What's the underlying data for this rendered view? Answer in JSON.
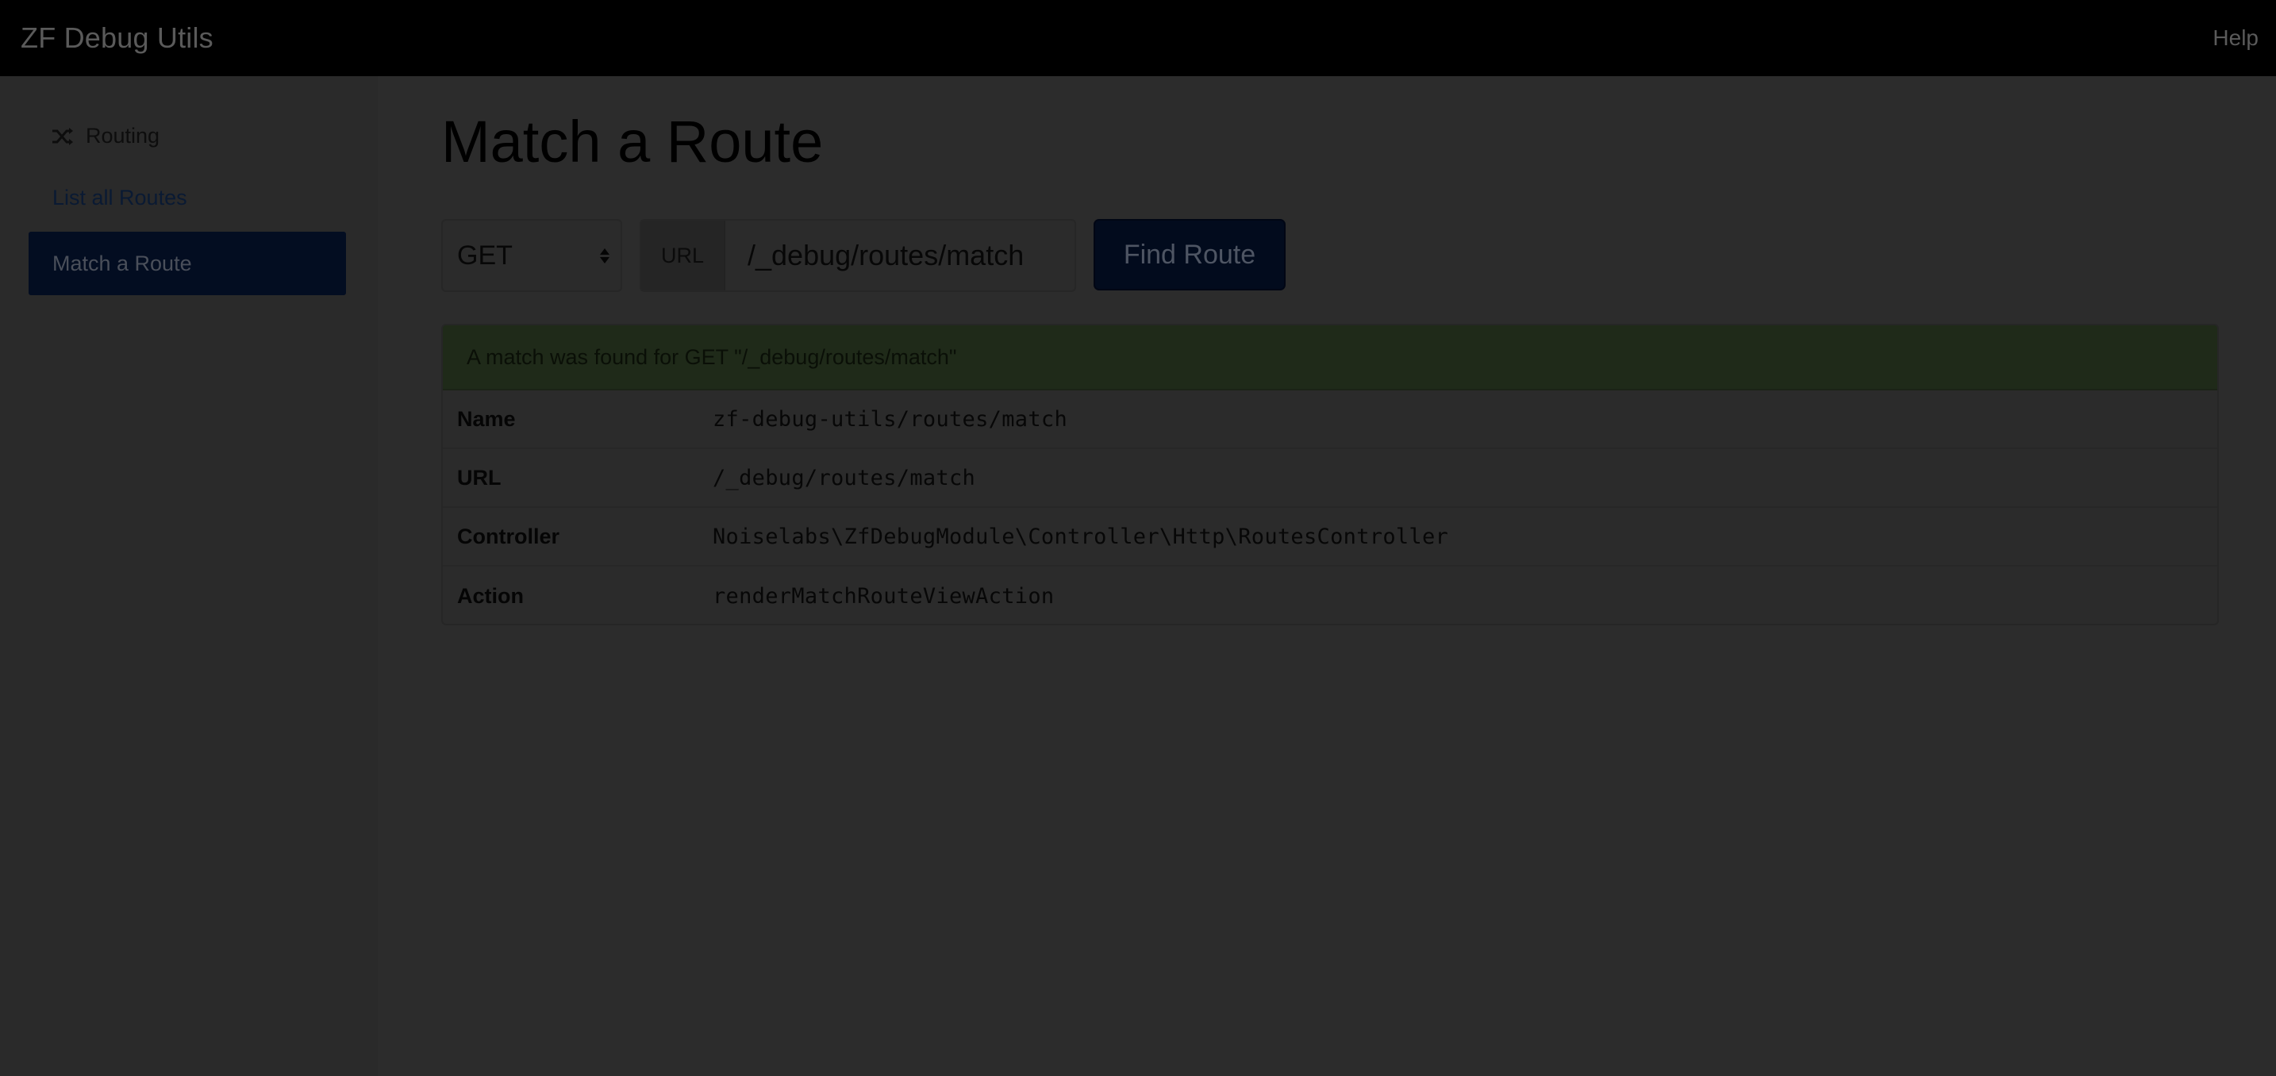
{
  "navbar": {
    "brand": "ZF Debug Utils",
    "help": "Help"
  },
  "sidebar": {
    "section": "Routing",
    "section_icon": "shuffle-icon",
    "items": [
      {
        "label": "List all Routes",
        "active": false
      },
      {
        "label": "Match a Route",
        "active": true
      }
    ]
  },
  "main": {
    "title": "Match a Route",
    "form": {
      "method": "GET",
      "url_addon": "URL",
      "url_value": "/_debug/routes/match",
      "submit": "Find Route"
    },
    "result": {
      "message": "A match was found for GET \"/_debug/routes/match\"",
      "rows": [
        {
          "label": "Name",
          "value": "zf-debug-utils/routes/match"
        },
        {
          "label": "URL",
          "value": "/_debug/routes/match"
        },
        {
          "label": "Controller",
          "value": "Noiselabs\\ZfDebugModule\\Controller\\Http\\RoutesController"
        },
        {
          "label": "Action",
          "value": "renderMatchRouteViewAction"
        }
      ]
    }
  },
  "colors": {
    "overlay_background": "#2b2b2b",
    "navbar": "#000000",
    "active_item": "#030d21",
    "success_heading": "#1f2a19"
  }
}
